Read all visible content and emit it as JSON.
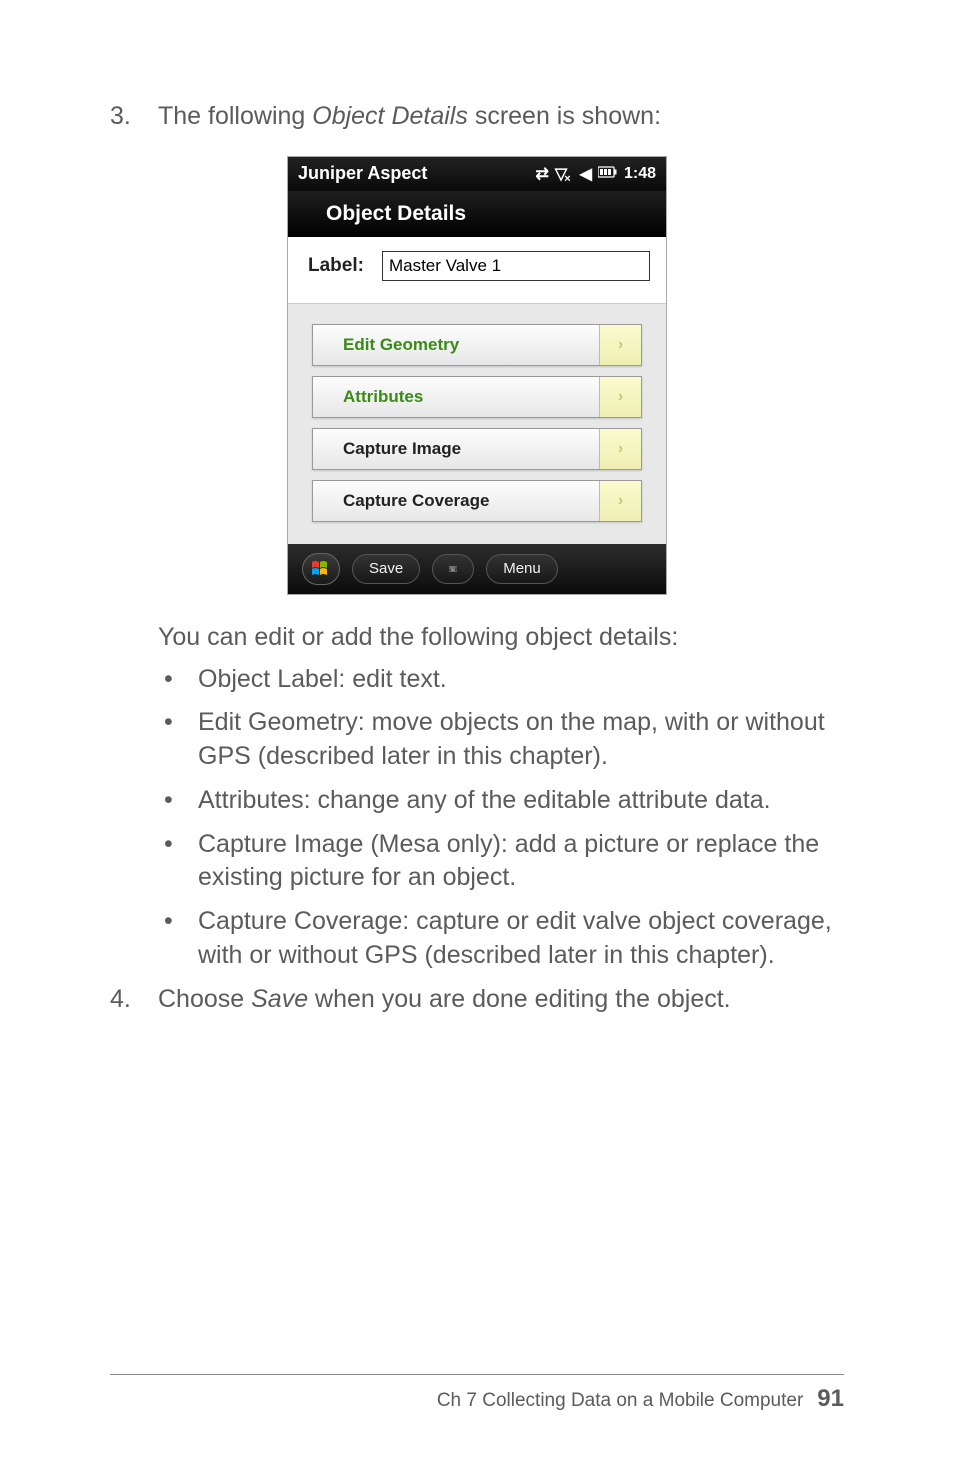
{
  "list": {
    "item3": {
      "num": "3.",
      "text_before": "The following ",
      "italic": "Object Details",
      "text_after": " screen is shown:"
    },
    "item4": {
      "num": "4.",
      "text_before": "Choose ",
      "italic": "Save",
      "text_after": " when you are done editing the object."
    }
  },
  "screenshot": {
    "title": "Juniper Aspect",
    "time": "1:48",
    "header": "Object Details",
    "label_text": "Label:",
    "label_value": "Master Valve 1",
    "buttons": {
      "edit_geometry": "Edit Geometry",
      "attributes": "Attributes",
      "capture_image": "Capture Image",
      "capture_coverage": "Capture Coverage"
    },
    "bottom": {
      "save": "Save",
      "menu": "Menu"
    },
    "icons": {
      "sync": "⇄",
      "signal": "▽",
      "volume": "◀",
      "battery": "▮",
      "signal_x": "×",
      "chev": "›"
    }
  },
  "after_text": "You can edit or add the following object details:",
  "bullets": [
    "Object Label: edit text.",
    "Edit Geometry: move objects on the map, with or without GPS (described later in this chapter).",
    "Attributes: change any of the editable attribute data.",
    "Capture Image (Mesa only): add a picture or replace the existing picture for an object.",
    "Capture Coverage: capture or edit valve object coverage, with or without GPS (described later in this chapter)."
  ],
  "footer": {
    "chapter": "Ch 7   Collecting Data on a Mobile Computer",
    "page": "91"
  }
}
